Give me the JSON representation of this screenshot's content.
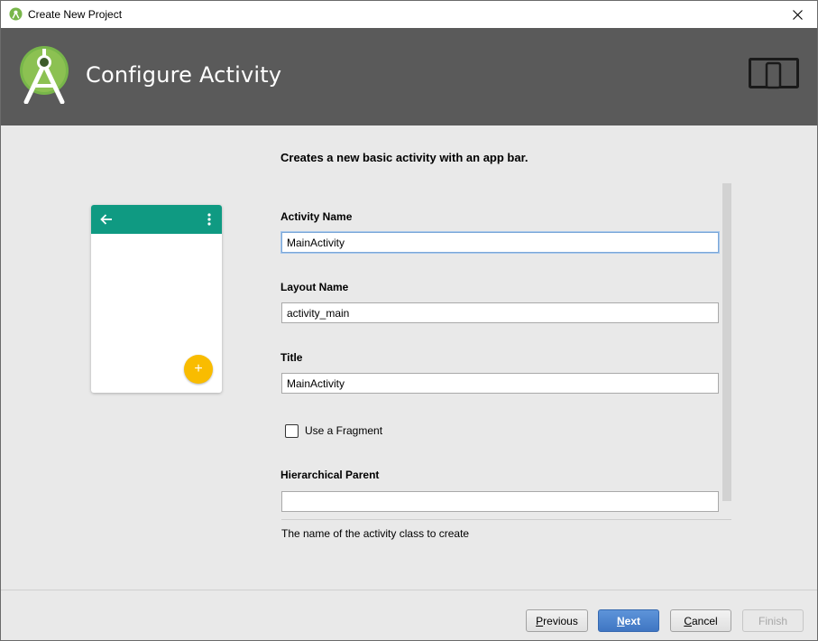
{
  "window": {
    "title": "Create New Project",
    "app_icon": "android-studio-icon",
    "close_icon": "close-icon"
  },
  "header": {
    "heading": "Configure Activity",
    "logo_icon": "android-studio-logo-icon",
    "device_icon": "tablet-phone-icon",
    "background": "#5a5a5a"
  },
  "main": {
    "description": "Creates a new basic activity with an app bar.",
    "preview": {
      "appbar_color": "#0f9a82",
      "fab_color": "#f9bc00",
      "fab_symbol": "+",
      "back_icon": "arrow-back-icon",
      "menu_icon": "more-vert-icon"
    },
    "fields": {
      "activity_name": {
        "label": "Activity Name",
        "value": "MainActivity"
      },
      "layout_name": {
        "label": "Layout Name",
        "value": "activity_main"
      },
      "title": {
        "label": "Title",
        "value": "MainActivity"
      },
      "use_fragment": {
        "label": "Use a Fragment",
        "checked": false
      },
      "hierarchical_parent": {
        "label": "Hierarchical Parent",
        "value": ""
      }
    },
    "help_text": "The name of the activity class to create"
  },
  "footer": {
    "previous": {
      "mnemonic": "P",
      "rest": "revious"
    },
    "next": {
      "mnemonic": "N",
      "rest": "ext"
    },
    "cancel": {
      "mnemonic": "C",
      "rest": "ancel"
    },
    "finish": "Finish"
  }
}
